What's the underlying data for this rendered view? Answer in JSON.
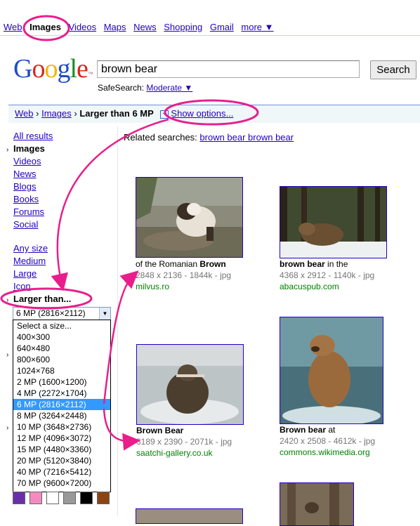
{
  "topnav": [
    "Web",
    "Images",
    "Videos",
    "Maps",
    "News",
    "Shopping",
    "Gmail",
    "more ▼"
  ],
  "logo": {
    "text": "Google",
    "colors": [
      "#1f4ec5",
      "#d7281b",
      "#f3b600",
      "#1f4ec5",
      "#1a8b24",
      "#d7281b"
    ]
  },
  "search": {
    "query": "brown bear",
    "button": "Search"
  },
  "safesearch": {
    "label": "SafeSearch:",
    "value": "Moderate ▼"
  },
  "breadcrumb": {
    "web": "Web",
    "sep": "›",
    "images": "Images",
    "current": "Larger than 6 MP",
    "show_options": "Show options..."
  },
  "left": {
    "types": [
      "All results",
      "Images",
      "Videos",
      "News",
      "Blogs",
      "Books",
      "Forums",
      "Social"
    ],
    "current_type": "Images",
    "sizes": [
      "Any size",
      "Medium",
      "Large",
      "Icon"
    ],
    "larger_than": "Larger than...",
    "dropdown_selected": "6 MP (2816×2112)",
    "dropdown_options": [
      "Select a size...",
      "400×300",
      "640×480",
      "800×600",
      "1024×768",
      "2 MP (1600×1200)",
      "4 MP (2272×1704)",
      "6 MP (2816×2112)",
      "8 MP (3264×2448)",
      "10 MP (3648×2736)",
      "12 MP (4096×3072)",
      "15 MP (4480×3360)",
      "20 MP (5120×3840)",
      "40 MP (7216×5412)",
      "70 MP (9600×7200)"
    ],
    "highlighted_index": 7,
    "swatch_colors": [
      "#6a2fa8",
      "#f58ac0",
      "#ffffff",
      "#999999",
      "#000000",
      "#8b4513"
    ]
  },
  "related": {
    "label": "Related searches:",
    "link": "brown bear brown bear"
  },
  "results": [
    {
      "title_plain": "of the Romanian ",
      "title_bold": "Brown",
      "meta": "2848 x 2136 - 1844k - jpg",
      "url": "milvus.ro"
    },
    {
      "title_bold": "brown bear",
      "title_plain": " in the",
      "meta": "4368 x 2912 - 1140k - jpg",
      "url": "abacuspub.com"
    },
    {
      "title_bold": "Brown Bear",
      "title_plain": "",
      "meta": "3189 x 2390 - 2071k - jpg",
      "url": "saatchi-gallery.co.uk"
    },
    {
      "title_bold": "Brown bear",
      "title_plain": " at",
      "meta": "2420 x 2508 - 4612k - jpg",
      "url": "commons.wikimedia.org"
    }
  ],
  "accent_color": "#e91e8c"
}
